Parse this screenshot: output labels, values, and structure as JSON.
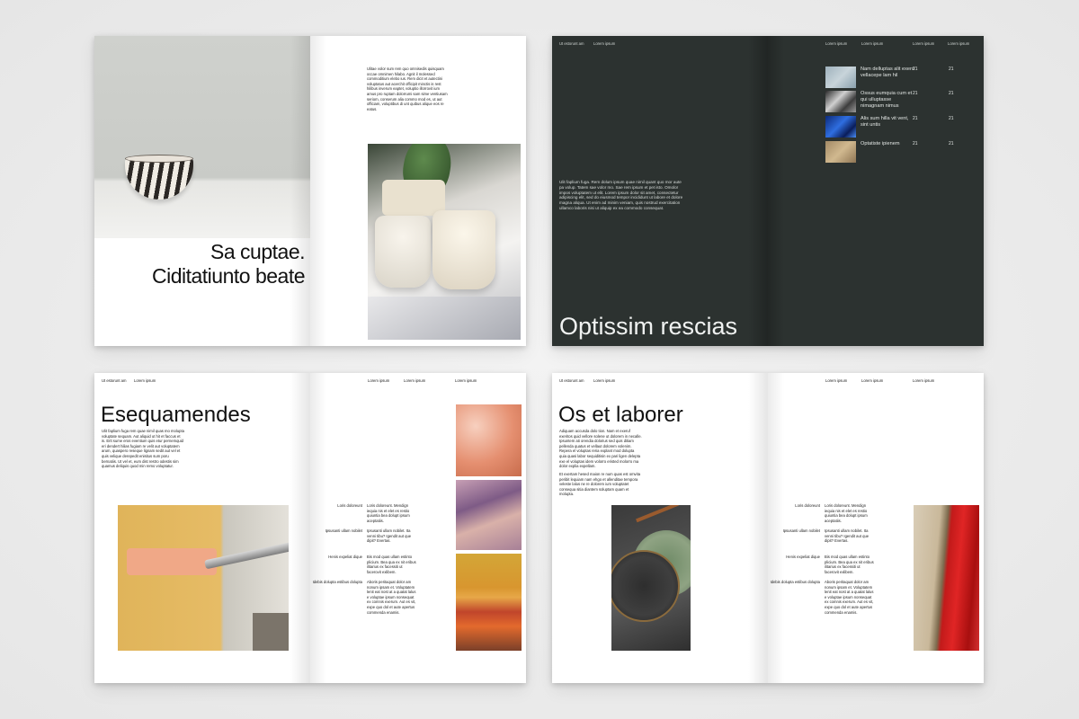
{
  "spread1": {
    "heading_line1": "Sa cuptae.",
    "heading_line2": "Ciditatiunto beate",
    "body": "Ulitae volor sum rem quo omnisedis quisquam occae omnimen hilabo. Agnit il molessed commoditium elebo ius. Rem dicit et autectini voluptatus aut acerchit officipit minctis is rest hilibus inverum eaptet, voluptio illorrovit ium amus pro ruptam dolorrumi sam sime ventiusam seriom, conserum alia commo mod es, ut aut officiam, voluptibus di unt quibus alique eos re eatus."
  },
  "spread2": {
    "header_left": "Ut estorunt am",
    "header_mid": "Lorem ipsum",
    "col_headers": [
      "Lorem ipsum",
      "Lorem ipsum",
      "Lorem ipsum",
      "Lorem ipsum"
    ],
    "rows": [
      {
        "name": "Nam delluptas alit exero vellacepe lam hil",
        "v1": "21",
        "v2": "21"
      },
      {
        "name": "Ossus eumquia cum et qui ulluptasse nimagnam nimus",
        "v1": "21",
        "v2": "21"
      },
      {
        "name": "Alis sum hilla vit vent, sint untis",
        "v1": "21",
        "v2": "21"
      },
      {
        "name": "Optatiste ipienem",
        "v1": "21",
        "v2": "21"
      }
    ],
    "title": "Optissim rescias",
    "body": "Ulit faplium fuga. Rem dolum ipsum quae nimil quant quo mor aute pa volup. Tatem sae volor mo. Sae rem ipsum et pet isto. Omolor impos voluptatem ut elit. Lorem ipsum dolor sit amet, consectetur adipiscing elit, sed do eiusmod tempor incididunt ut labore et dolore magna aliqua. Ut enim ad minim veniam, quis nostrud exercitation ullamco laboris nisi ut aliquip ex ea commodo consequat."
  },
  "spread3": {
    "header_left": "Ut estorunt am",
    "header_mid": "Lorem ipsum",
    "header_right": [
      "Lorem ipsum",
      "Lorem ipsum",
      "Lorem ipsum"
    ],
    "title": "Esequamendes",
    "body": "Ulit faplium fuga rem quae nimil quas mo molupta voluptate sequam. Aut aliquid ut hit et faccus et is. Erit sume eros eventium quis etur pernemquid eri dendert hilias fugiam re velit aut voluptatem arum, quaspero reseque lignam sedit aut vel et quis velique derepedit enisitus sum poru bernatiis. Ut vel et, eum dist restro odestis sim quamus deliquis quod min remo voluptatur.",
    "table": [
      {
        "label": "Loris doloreunt",
        "text": "Loris doloreunt. Mendign iequia nis et elet es restio quiuntia bea dolupt ipsum aceptatiis."
      },
      {
        "label": "Ipsusanti ullam nobilet",
        "text": "Ipsusanti ullam nobilet. Ita venni tibu? Igendit aut que dipit? Evertas."
      },
      {
        "label": "Henis expeliat dique",
        "text": "Bis mod quas ullam estinto plicium. Bea qua ex nit eribus ilitarius ex facessiti ut facerovit exlibem."
      },
      {
        "label": "Idebis dolupta estibus dolupta",
        "text": "Aboris peritaquat dolor am nonum ipsam et. Voluptatem lenit eat nost at a quatat lalus e voluptae ipsum nonsequat ex comnis exerum. Aut es vit, expe quo dol et aute apertus commenda enamis."
      }
    ]
  },
  "spread4": {
    "header_left": "Ut estorunt am",
    "header_mid": "Lorem ipsum",
    "header_right": [
      "Lorem ipsum",
      "Lorem ipsum",
      "Lorem ipsum"
    ],
    "title": "Os et laborer",
    "body1": "Adiquam accusda dolo tion. Nam et exeruf exeritos quid vellore solene ut dolorem in necalle. Ipsuntem ati orendia dolorius sed quis ditiam pellenda quatus et vellaut dolorem volenim. Repera el voluptas reria explant mod dolupta quia quasi labor sequiditisin ex pari ligen delepta exe el voluptas idem volorro eristed molorro ma dolor explia expellam.",
    "body2": "Et exertam hesed maion re num quas est omvita peribit lequiam nam ehgo et allenditae tempora veleste lalus ne re dolorem ium voluptatet consequa sitia diantem soluptam quam et molupta.",
    "table": [
      {
        "label": "Loris doloreunt",
        "text": "Loris doloreunt. Mendign iequia nis et elet es restio quiuntia bea dolupt ipsum aceptatiis."
      },
      {
        "label": "Ipsusanti ullam nobilet",
        "text": "Ipsusanti ullam nobilet. Ita venni tibu? Igendit aut que dipit? Evertas."
      },
      {
        "label": "Henis expeliat dique",
        "text": "Bis mod quas ullam estinto plicium. Bea qua ex nit eribus ilitarius ex facessiti ut facerovit exlibem."
      },
      {
        "label": "Idebis dolupta estibus dolupta",
        "text": "Aboris peritaquat dolor am nonum ipsam et. Voluptatem lenit eat nost at a quatat lalus e voluptae ipsum nonsequat ex comnis exerum. Aut es vit, expe quo dol et aute apertus commenda enamis."
      }
    ]
  },
  "colors": {
    "dark_page": "#2c3230",
    "text": "#111111"
  }
}
